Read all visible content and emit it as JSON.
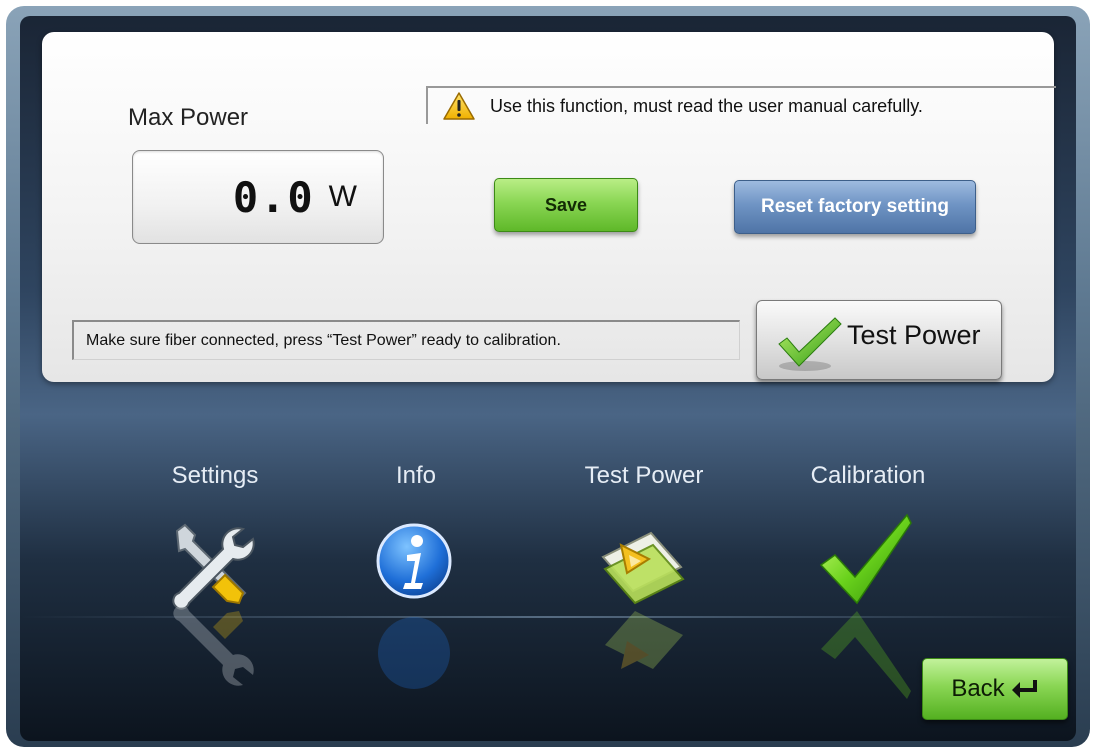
{
  "panel": {
    "max_power_label": "Max Power",
    "power_value": "0.0",
    "power_unit": "W",
    "warning_text": "Use this function, must read the user manual carefully.",
    "save_label": "Save",
    "reset_label": "Reset factory setting",
    "hint_text": "Make sure fiber connected, press “Test Power” ready to calibration.",
    "test_power_label": "Test Power"
  },
  "nav": {
    "items": [
      {
        "label": "Settings",
        "icon": "tools-icon"
      },
      {
        "label": "Info",
        "icon": "info-icon"
      },
      {
        "label": "Test Power",
        "icon": "ruler-triangle-icon"
      },
      {
        "label": "Calibration",
        "icon": "check-icon"
      }
    ]
  },
  "back_label": "Back",
  "colors": {
    "accent_green": "#8ad654",
    "accent_blue": "#6f94c4"
  }
}
